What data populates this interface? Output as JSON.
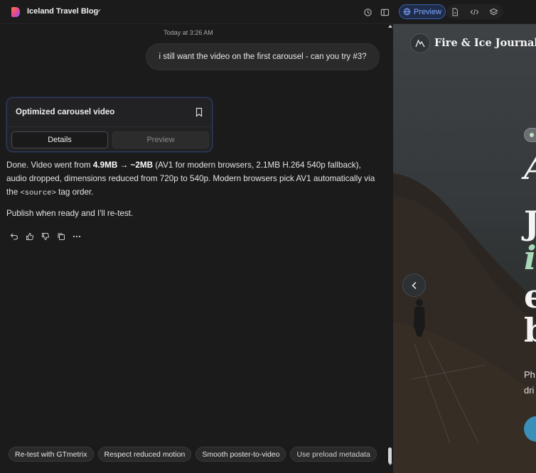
{
  "topbar": {
    "project_title": "Iceland Travel Blog",
    "preview_label": "Preview",
    "icons": [
      "history-icon",
      "sidebar-icon",
      "globe-icon",
      "file-icon",
      "code-icon",
      "layers-icon"
    ],
    "accent": "#3b5ea8"
  },
  "chat": {
    "timestamp": "Today at 3:26 AM",
    "user_message": "i still want the video on the first carousel - can you try #3?",
    "card": {
      "title": "Optimized carousel video",
      "details_label": "Details",
      "preview_label": "Preview"
    },
    "reply": {
      "p1_a": "Done. Video went from ",
      "p1_bold": "4.9MB → ~2MB",
      "p1_b": " (AV1 for modern browsers, 2.1MB H.264 540p fallback), audio dropped, dimensions reduced from 720p to 540p. Modern browsers pick AV1 automatically via the ",
      "p1_code": "<source>",
      "p1_c": " tag order.",
      "p2": "Publish when ready and I'll re-test."
    },
    "actions": [
      "undo-icon",
      "thumbs-up-icon",
      "thumbs-down-icon",
      "copy-icon",
      "more-icon"
    ],
    "chips": [
      "Re-test with GTmetrix",
      "Respect reduced motion",
      "Smooth poster-to-video",
      "Use preload metadata"
    ]
  },
  "preview": {
    "site_name": "Fire & Ice Journal",
    "hero": {
      "line1": "A",
      "line2": "J",
      "line3": "i",
      "line4": "e",
      "line5": "b",
      "sub1": "Ph",
      "sub2": "dri"
    },
    "accent_green": "#a8d8b8",
    "cta_color": "#3a8fb7"
  }
}
